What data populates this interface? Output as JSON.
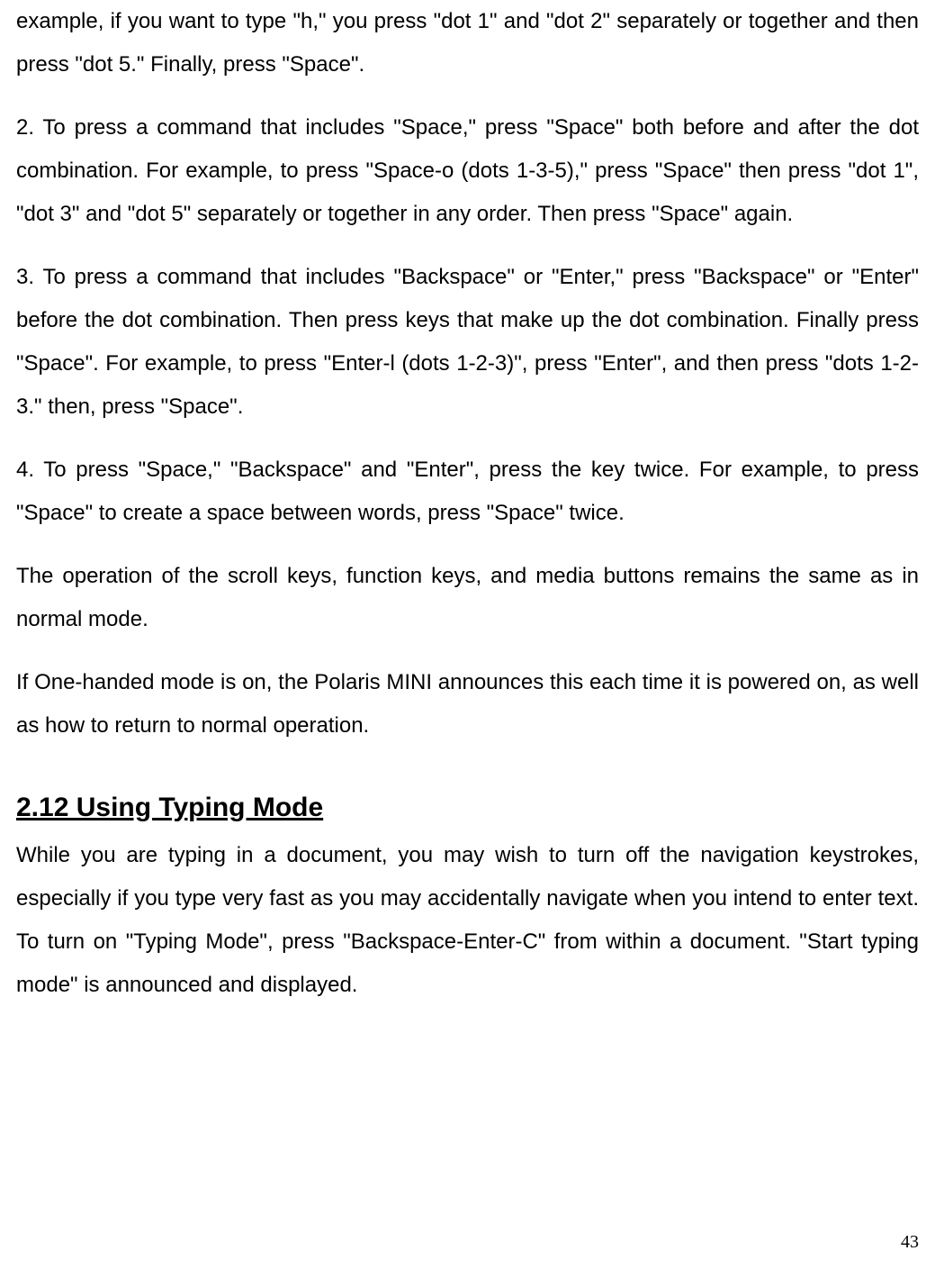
{
  "paragraphs": {
    "p1": "example, if you want to type \"h,\" you press \"dot 1\" and \"dot 2\" separately or together and then press \"dot 5.\" Finally, press \"Space\".",
    "p2": "2. To press a command that includes \"Space,\" press \"Space\" both before and after the dot combination. For example, to press \"Space-o (dots 1-3-5),\" press \"Space\" then press \"dot 1\", \"dot 3\" and \"dot 5\" separately or together in any order. Then press \"Space\" again.",
    "p3": "3. To press a command that includes \"Backspace\" or \"Enter,\" press \"Backspace\" or \"Enter\" before the dot combination. Then press keys that make up the dot combination. Finally press \"Space\". For example, to press \"Enter-l (dots 1-2-3)\", press \"Enter\", and then press \"dots 1-2-3.\" then, press \"Space\".",
    "p4": "4. To press \"Space,\" \"Backspace\" and \"Enter\", press the key twice. For example, to press \"Space\" to create a space between words, press \"Space\" twice.",
    "p5": "The operation of the scroll keys, function keys, and media buttons remains the same as in normal mode.",
    "p6": "If One-handed mode is on, the Polaris MINI announces this each time it is powered on, as well as how to return to normal operation."
  },
  "heading": "2.12 Using Typing Mode",
  "section_paragraph": "While you are typing in a document, you may wish to turn off the navigation keystrokes, especially if you type very fast as you may accidentally navigate when you intend to enter text. To turn on \"Typing Mode\", press \"Backspace-Enter-C\" from within a document. \"Start typing mode\" is announced and displayed.",
  "page_number": "43"
}
